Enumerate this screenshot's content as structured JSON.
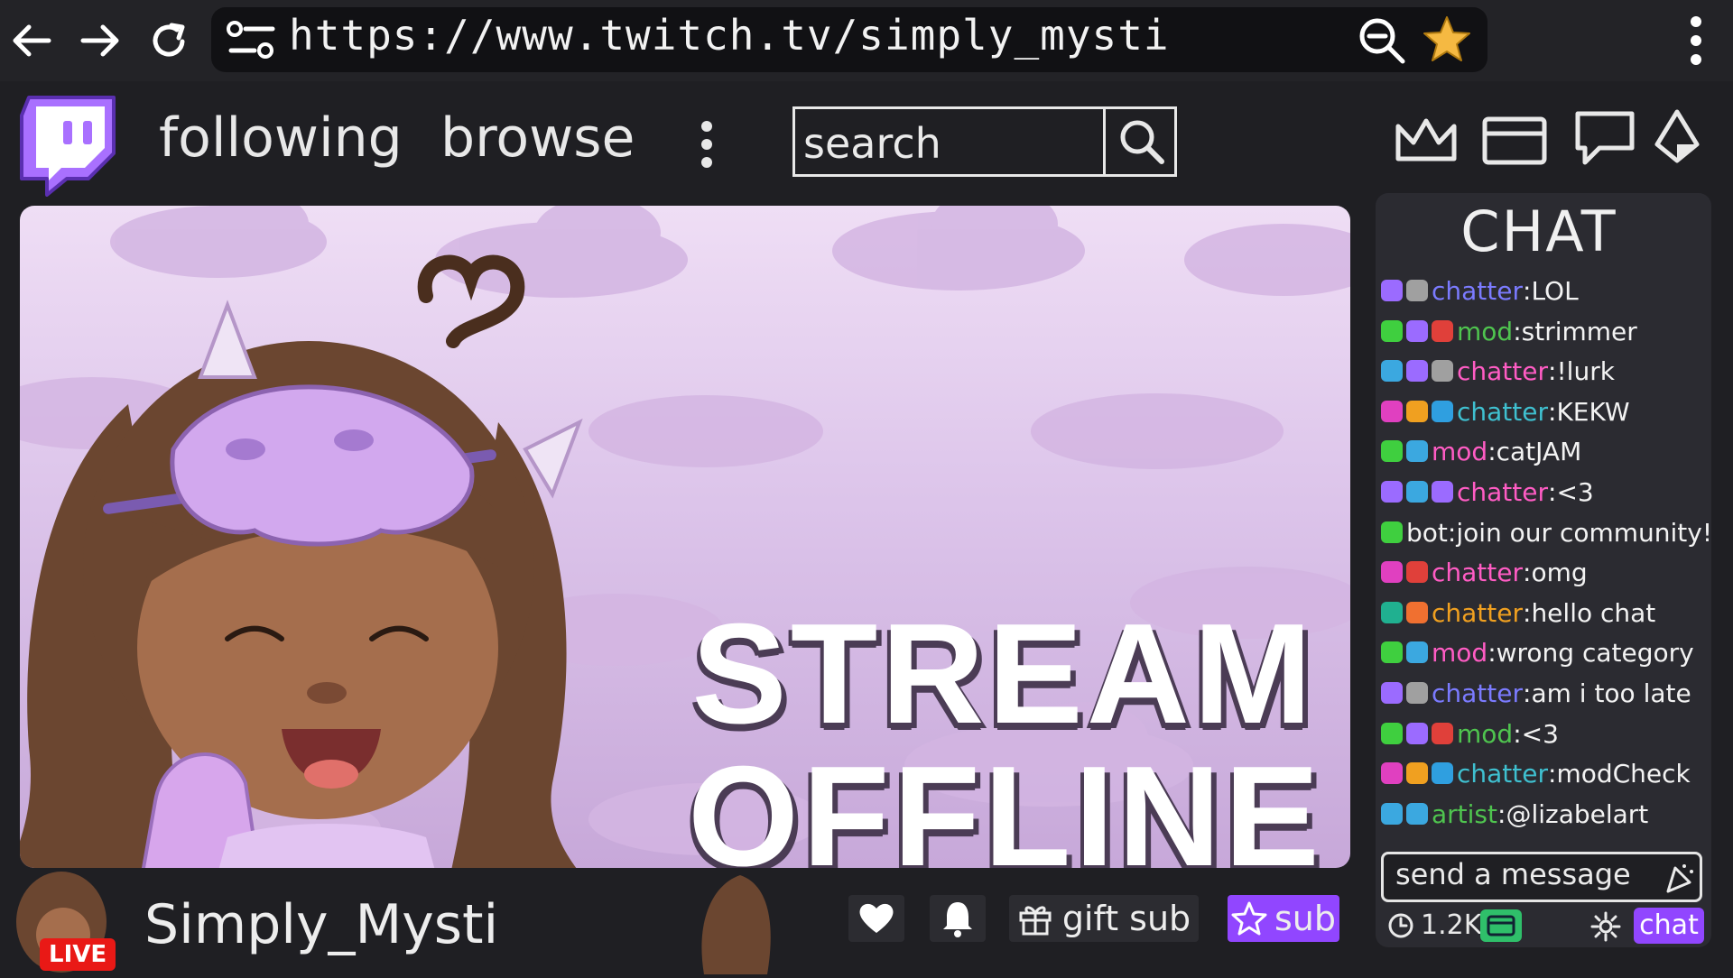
{
  "browser": {
    "url": "https://www.twitch.tv/simply_mysti"
  },
  "nav": {
    "following": "following",
    "browse": "browse",
    "search_placeholder": "search"
  },
  "offline": {
    "line1": "STREAM",
    "line2": "OFFLINE"
  },
  "streamer": {
    "name": "Simply_Mysti",
    "live_badge": "LIVE"
  },
  "actions": {
    "gift_sub": "gift sub",
    "sub": "sub"
  },
  "chat": {
    "title": "CHAT",
    "messages": [
      {
        "user": "chatter",
        "text": "LOL",
        "color": "#7b7bff",
        "badges": [
          "#9b6bff",
          "#a0a0a0"
        ]
      },
      {
        "user": "mod",
        "text": "strimmer",
        "color": "#4fc44f",
        "badges": [
          "#3fcf3f",
          "#9b6bff",
          "#e0403a"
        ]
      },
      {
        "user": "chatter",
        "text": "!lurk",
        "color": "#ff5cc4",
        "badges": [
          "#3ba8e0",
          "#9b6bff",
          "#a0a0a0"
        ]
      },
      {
        "user": "chatter",
        "text": "KEKW",
        "color": "#3fc0d0",
        "badges": [
          "#e040c0",
          "#f0a020",
          "#2f9fe0"
        ]
      },
      {
        "user": "mod",
        "text": "catJAM",
        "color": "#ff5cc4",
        "badges": [
          "#3fcf3f",
          "#3ba8e0"
        ]
      },
      {
        "user": "chatter",
        "text": "<3",
        "color": "#ff5cc4",
        "badges": [
          "#9b6bff",
          "#3ba8e0",
          "#9b6bff"
        ]
      },
      {
        "user": "bot",
        "text": "join our community!",
        "color": "#f3f3f3",
        "badges": [
          "#3fcf3f"
        ]
      },
      {
        "user": "chatter",
        "text": "omg",
        "color": "#ff5cc4",
        "badges": [
          "#e040c0",
          "#e0403a"
        ]
      },
      {
        "user": "chatter",
        "text": "hello chat",
        "color": "#f0a020",
        "badges": [
          "#20b090",
          "#f07030"
        ]
      },
      {
        "user": "mod",
        "text": "wrong category",
        "color": "#ff5cc4",
        "badges": [
          "#3fcf3f",
          "#3ba8e0"
        ]
      },
      {
        "user": "chatter",
        "text": "am i too late",
        "color": "#7b7bff",
        "badges": [
          "#9b6bff",
          "#a0a0a0"
        ]
      },
      {
        "user": "mod",
        "text": "<3",
        "color": "#4fc44f",
        "badges": [
          "#3fcf3f",
          "#9b6bff",
          "#e0403a"
        ]
      },
      {
        "user": "chatter",
        "text": "modCheck",
        "color": "#3fc0d0",
        "badges": [
          "#e040c0",
          "#f0a020",
          "#2f9fe0"
        ]
      },
      {
        "user": "artist",
        "text": "@lizabelart",
        "color": "#4fc44f",
        "badges": [
          "#3ba8e0",
          "#3ba8e0"
        ]
      }
    ],
    "send_placeholder": "send a message",
    "viewer_count": "1.2K",
    "chat_button": "chat"
  },
  "colors": {
    "accent": "#9146ff",
    "background": "#1f1f23",
    "panel": "#2b2b31"
  }
}
